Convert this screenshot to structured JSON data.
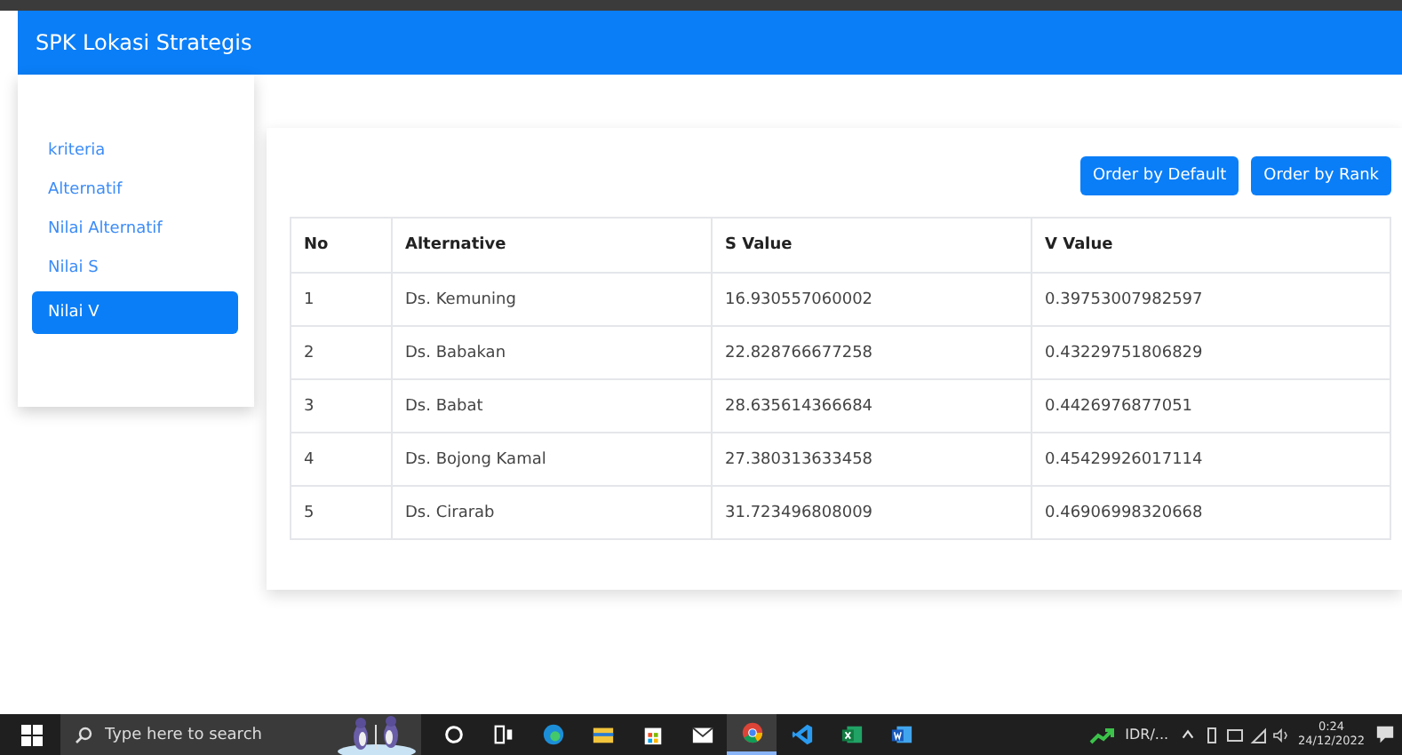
{
  "navbar": {
    "title": "SPK Lokasi Strategis"
  },
  "sidebar": {
    "items": [
      {
        "label": "kriteria",
        "selected": false
      },
      {
        "label": "Alternatif",
        "selected": false
      },
      {
        "label": "Nilai Alternatif",
        "selected": false
      },
      {
        "label": "Nilai S",
        "selected": false
      },
      {
        "label": "Nilai V",
        "selected": true
      }
    ]
  },
  "buttons": [
    "Order by Default",
    "Order by Rank"
  ],
  "table": {
    "columns": [
      "No",
      "Alternative",
      "S Value",
      "V Value"
    ],
    "rows": [
      [
        "1",
        "Ds. Kemuning",
        "16.930557060002",
        "0.39753007982597"
      ],
      [
        "2",
        "Ds. Babakan",
        "22.828766677258",
        "0.43229751806829"
      ],
      [
        "3",
        "Ds. Babat",
        "28.635614366684",
        "0.4426976877051"
      ],
      [
        "4",
        "Ds. Bojong Kamal",
        "27.380313633458",
        "0.45429926017114"
      ],
      [
        "5",
        "Ds. Cirarab",
        "31.723496808009",
        "0.46906998320668"
      ]
    ]
  },
  "taskbar": {
    "search": {
      "placeholder": "Type here to search"
    },
    "apps": [
      {
        "kind": "cortana",
        "active": false
      },
      {
        "kind": "taskview",
        "active": false
      },
      {
        "kind": "edge",
        "active": false
      },
      {
        "kind": "explorer",
        "active": false
      },
      {
        "kind": "store",
        "active": false
      },
      {
        "kind": "mail",
        "active": false
      },
      {
        "kind": "chrome",
        "active": true
      },
      {
        "kind": "vscode",
        "active": false
      },
      {
        "kind": "excel",
        "active": false
      },
      {
        "kind": "word",
        "active": false
      }
    ],
    "ticker": "IDR/...",
    "time": "0:24",
    "date": "24/12/2022"
  }
}
